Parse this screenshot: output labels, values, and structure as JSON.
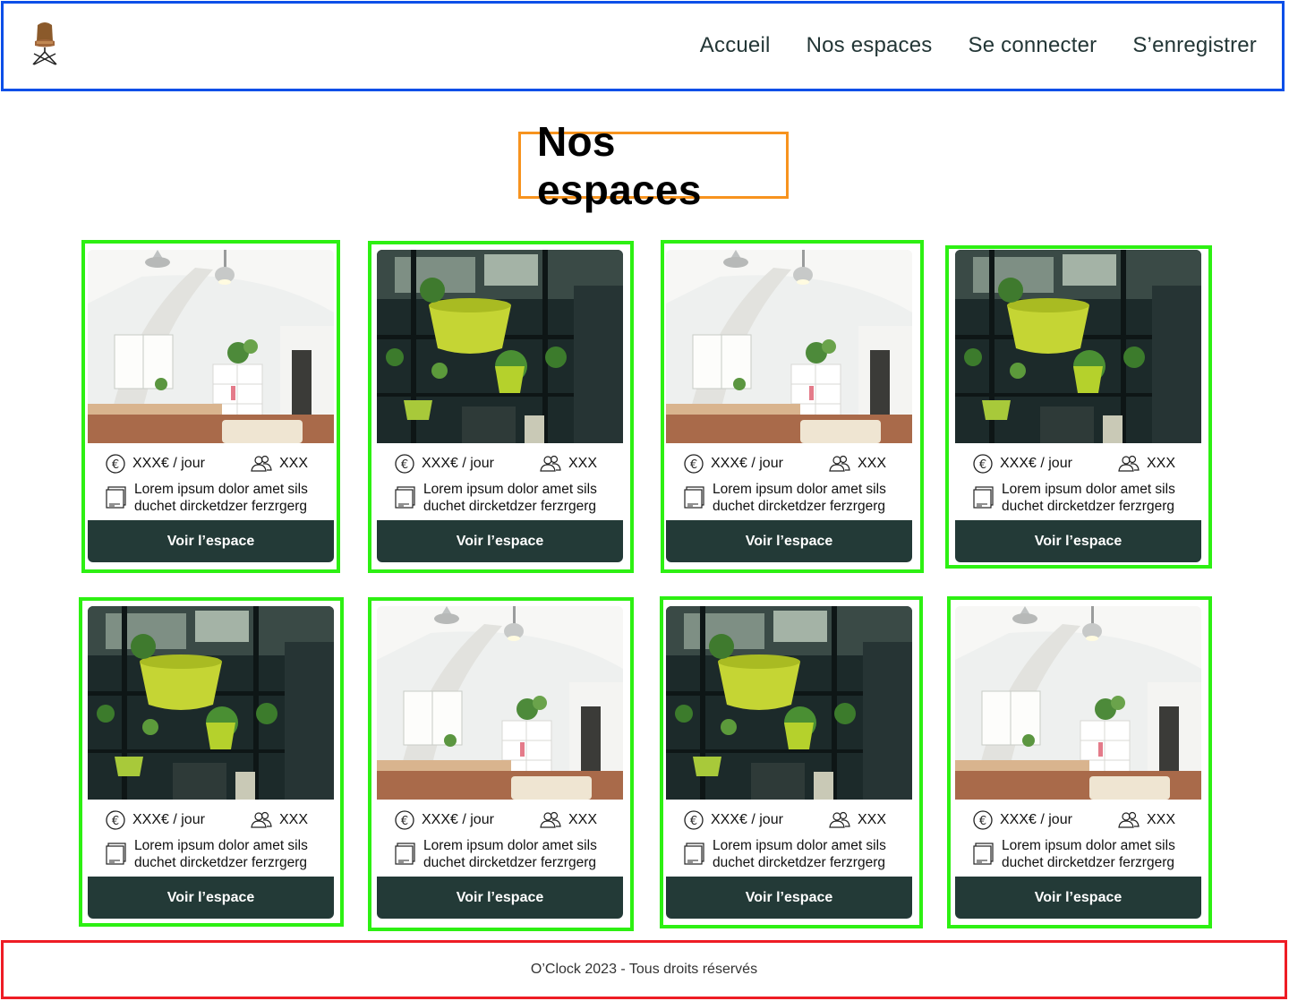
{
  "header": {
    "logo_icon": "chair-logo-icon",
    "nav": [
      {
        "label": "Accueil"
      },
      {
        "label": "Nos espaces"
      },
      {
        "label": "Se connecter"
      },
      {
        "label": "S’enregistrer"
      }
    ]
  },
  "page_title": "Nos espaces",
  "cards": [
    {
      "image": "office",
      "price": "XXX€ / jour",
      "capacity": "XXX",
      "description": "Lorem ipsum dolor amet sils duchet dircketdzer ferzrgerg",
      "button": "Voir l’espace"
    },
    {
      "image": "plants",
      "price": "XXX€ / jour",
      "capacity": "XXX",
      "description": "Lorem ipsum dolor amet sils duchet dircketdzer ferzrgerg",
      "button": "Voir l’espace"
    },
    {
      "image": "office",
      "price": "XXX€ / jour",
      "capacity": "XXX",
      "description": "Lorem ipsum dolor amet sils duchet dircketdzer ferzrgerg",
      "button": "Voir l’espace"
    },
    {
      "image": "plants",
      "price": "XXX€ / jour",
      "capacity": "XXX",
      "description": "Lorem ipsum dolor amet sils duchet dircketdzer ferzrgerg",
      "button": "Voir l’espace"
    },
    {
      "image": "plants",
      "price": "XXX€ / jour",
      "capacity": "XXX",
      "description": "Lorem ipsum dolor amet sils duchet dircketdzer ferzrgerg",
      "button": "Voir l’espace"
    },
    {
      "image": "office",
      "price": "XXX€ / jour",
      "capacity": "XXX",
      "description": "Lorem ipsum dolor amet sils duchet dircketdzer ferzrgerg",
      "button": "Voir l’espace"
    },
    {
      "image": "plants",
      "price": "XXX€ / jour",
      "capacity": "XXX",
      "description": "Lorem ipsum dolor amet sils duchet dircketdzer ferzrgerg",
      "button": "Voir l’espace"
    },
    {
      "image": "office",
      "price": "XXX€ / jour",
      "capacity": "XXX",
      "description": "Lorem ipsum dolor amet sils duchet dircketdzer ferzrgerg",
      "button": "Voir l’espace"
    }
  ],
  "icons": {
    "price": "euro-icon",
    "capacity": "people-icon",
    "description": "book-icon"
  },
  "footer": {
    "text": "O’Clock 2023 - Tous droits réservés"
  },
  "colors": {
    "header_border": "#0b4fe8",
    "title_border": "#f7931e",
    "card_border": "#2df012",
    "footer_border": "#ee1c25",
    "button_bg": "#233a37"
  }
}
